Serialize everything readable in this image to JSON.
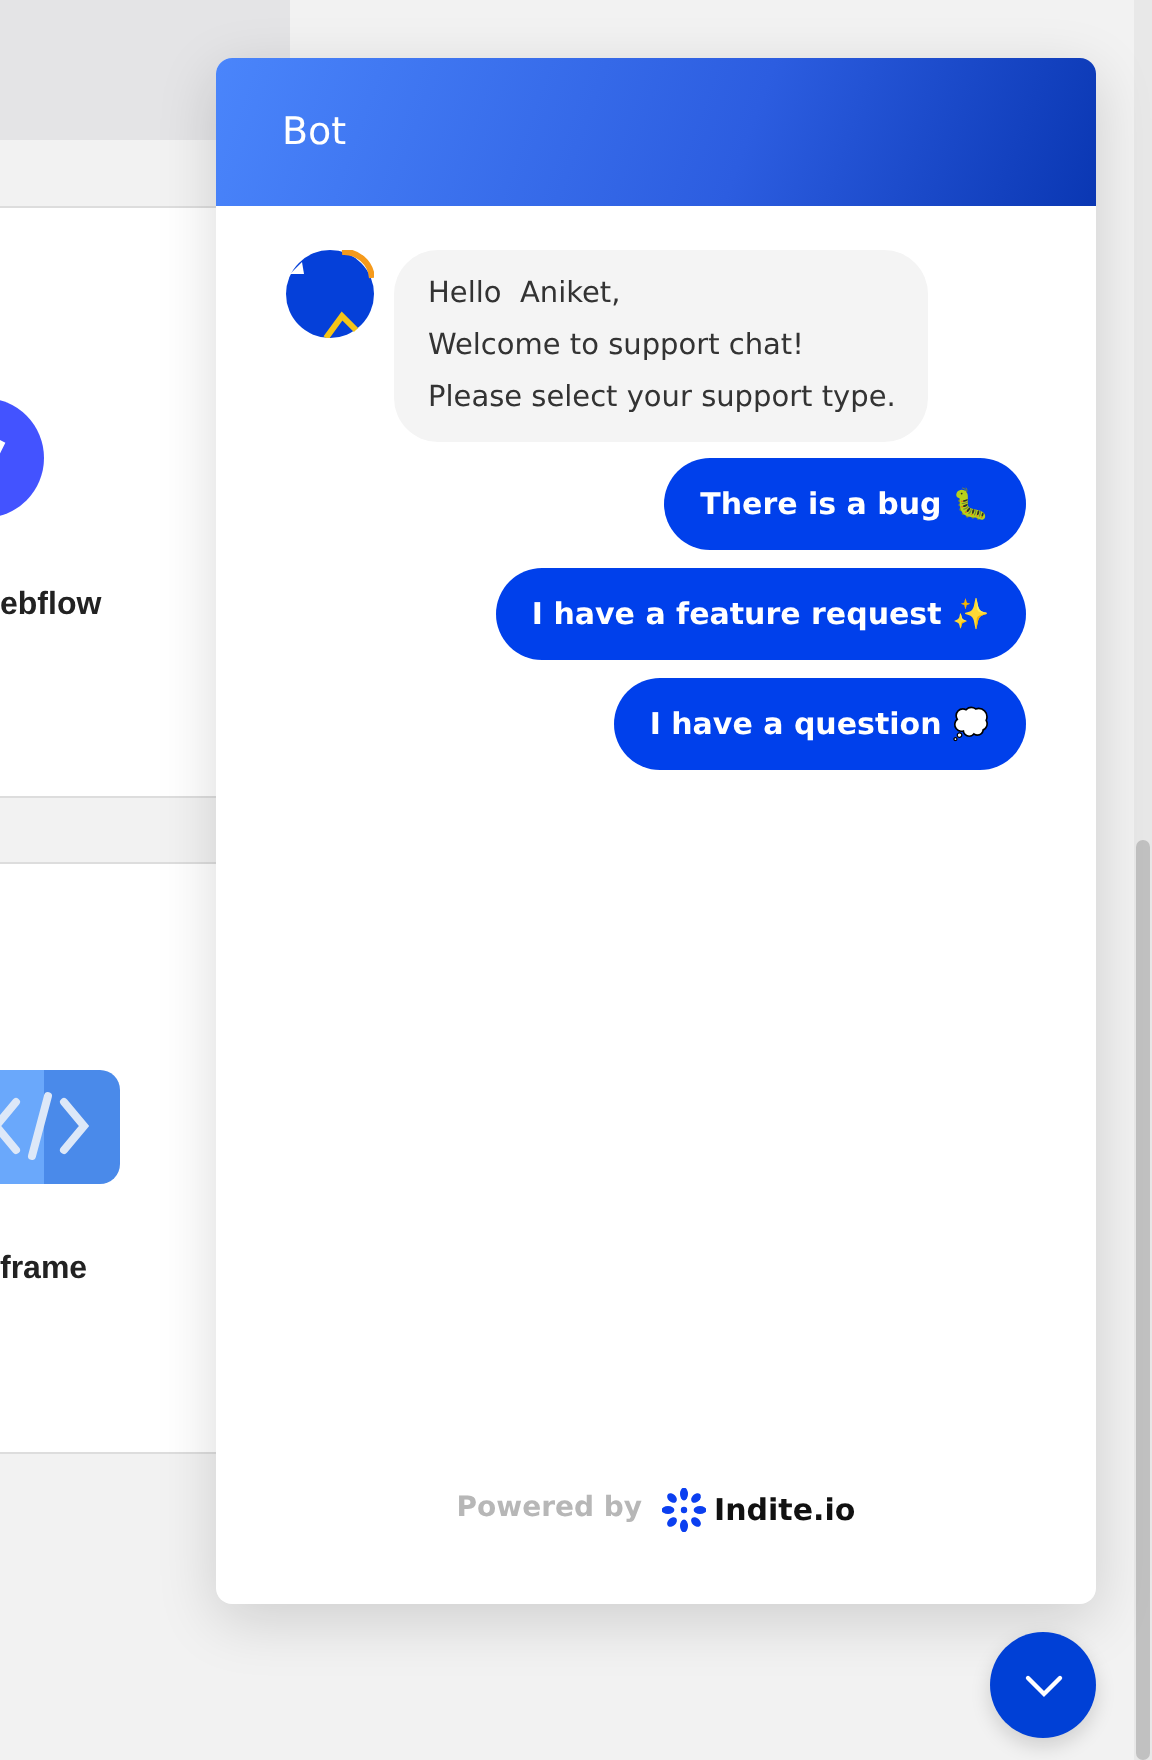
{
  "background_cards": [
    {
      "kind": "webflow",
      "label": "ebflow"
    },
    {
      "kind": "code",
      "label": "frame"
    }
  ],
  "chat": {
    "title": "Bot",
    "message": [
      "Hello  Aniket,",
      "Welcome to support chat!",
      "Please select your support type."
    ],
    "options": [
      "There is a bug 🐛",
      "I have a feature request ✨",
      "I have a question 💭"
    ],
    "footer": {
      "powered_by": "Powered by",
      "brand": "Indite.io"
    }
  }
}
